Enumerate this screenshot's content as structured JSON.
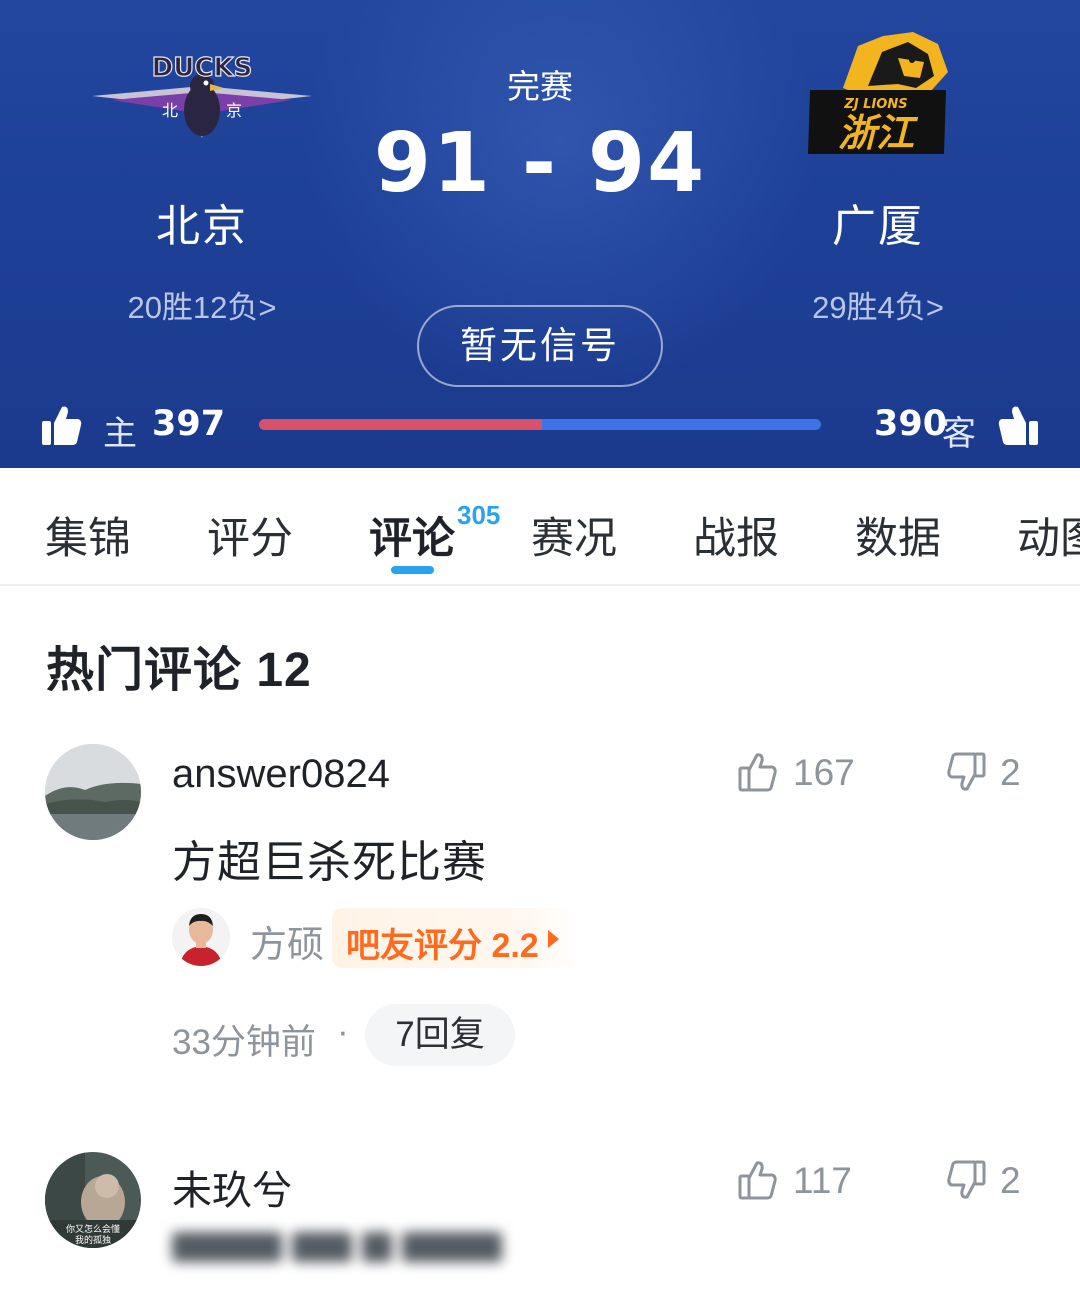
{
  "match": {
    "status": "完赛",
    "home_score": "91",
    "dash": "-",
    "away_score": "94",
    "signal_button": "暂无信号"
  },
  "home_team": {
    "name": "北京",
    "record": "20胜12负",
    "record_arrow": ">",
    "logo_text": "DUCKS",
    "logo_sub_left": "北",
    "logo_sub_right": "京",
    "color": "#7b3fa8"
  },
  "away_team": {
    "name": "广厦",
    "record": "29胜4负",
    "record_arrow": ">",
    "logo_text": "ZJ LIONS",
    "logo_main": "浙江",
    "color": "#f2b51f"
  },
  "votes": {
    "home_label": "主",
    "home_count": "397",
    "away_count": "390",
    "away_label": "客",
    "home_share": 0.504,
    "home_color": "#d9506a",
    "away_color": "#3e73e6"
  },
  "tabs": [
    {
      "label": "集锦",
      "active": false
    },
    {
      "label": "评分",
      "active": false
    },
    {
      "label": "评论",
      "badge": "305",
      "active": true
    },
    {
      "label": "赛况",
      "active": false
    },
    {
      "label": "战报",
      "active": false
    },
    {
      "label": "数据",
      "active": false
    },
    {
      "label": "动图",
      "active": false
    }
  ],
  "section": {
    "title": "热门评论 12"
  },
  "comments": [
    {
      "username": "answer0824",
      "likes": "167",
      "dislikes": "2",
      "text": "方超巨杀死比赛",
      "player_name": "方硕",
      "rating_label": "吧友评分 2.2",
      "time": "33分钟前",
      "dot": "·",
      "replies": "7回复"
    },
    {
      "username": "未玖兮",
      "likes": "117",
      "dislikes": "2",
      "avatar_caption_1": "你又怎么会懂",
      "avatar_caption_2": "我的孤独"
    }
  ],
  "accent_color": "#2aa3ef",
  "rating_color": "#ff6a1f"
}
